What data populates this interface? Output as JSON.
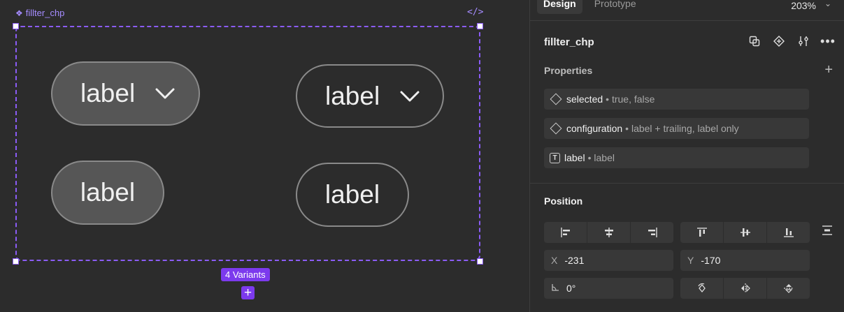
{
  "canvas": {
    "frame_title": "fillter_chp",
    "frame_title_icon": "component-set-icon",
    "code_icon": "code-icon",
    "variants_label": "4 Variants",
    "chips": [
      {
        "label": "label",
        "selected": true,
        "trailing": true
      },
      {
        "label": "label",
        "selected": false,
        "trailing": true
      },
      {
        "label": "label",
        "selected": true,
        "trailing": false
      },
      {
        "label": "label",
        "selected": false,
        "trailing": false
      }
    ],
    "selection_color": "#8b5cf6"
  },
  "panel": {
    "tabs": [
      "Design",
      "Prototype"
    ],
    "active_tab": "Design",
    "zoom": "203%",
    "component_name": "fillter_chp",
    "properties_title": "Properties",
    "properties": [
      {
        "icon": "variant-diamond-icon",
        "name": "selected",
        "value": "• true, false"
      },
      {
        "icon": "variant-diamond-icon",
        "name": "configuration",
        "value": "• label + trailing, label only"
      },
      {
        "icon": "text-property-icon",
        "name": "label",
        "value": "• label"
      }
    ],
    "position_title": "Position",
    "x_label": "X",
    "x_value": "-231",
    "y_label": "Y",
    "y_value": "-170",
    "rotation_value": "0°"
  }
}
